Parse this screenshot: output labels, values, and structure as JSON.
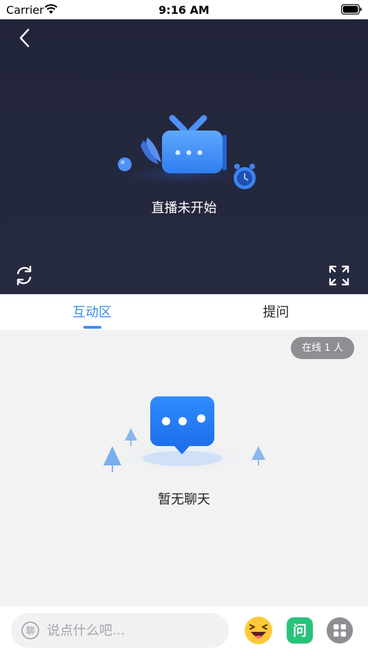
{
  "status_bar": {
    "carrier": "Carrier",
    "time": "9:16 AM"
  },
  "player": {
    "status_text": "直播未开始",
    "icons": [
      "back-icon",
      "refresh-icon",
      "fullscreen-icon"
    ]
  },
  "tabs": [
    {
      "label": "互动区",
      "active": true
    },
    {
      "label": "提问",
      "active": false
    }
  ],
  "chat": {
    "online_label": "在线 1 人",
    "empty_text": "暂无聊天"
  },
  "bottom_bar": {
    "input_placeholder": "说点什么吧...",
    "chat_icon_char": "聊",
    "ask_button_label": "问"
  },
  "colors": {
    "accent": "#3a8ff0",
    "player_bg": "#22253a",
    "ask_green": "#28c37a",
    "badge_gray": "#8e8e93"
  }
}
